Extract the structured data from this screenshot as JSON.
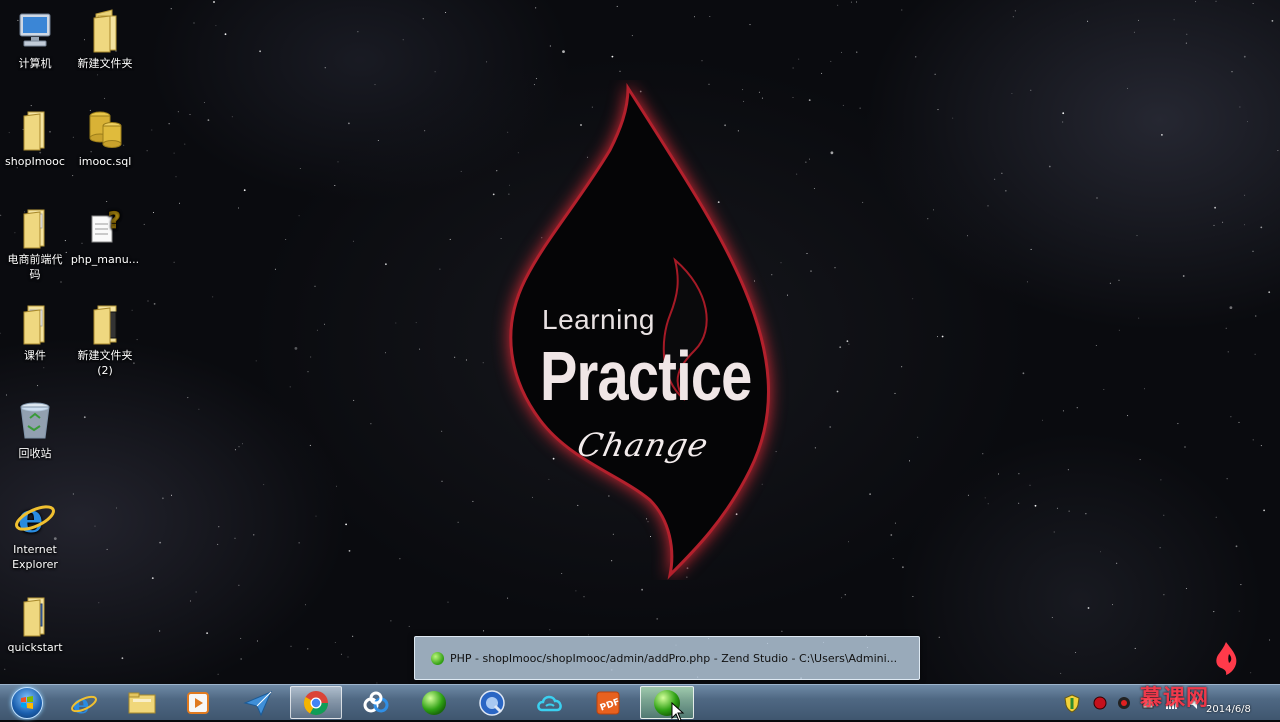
{
  "desktop": {
    "icons": [
      {
        "label": "计算机"
      },
      {
        "label": "新建文件夹"
      },
      {
        "label": "shopImooc"
      },
      {
        "label": "imooc.sql"
      },
      {
        "label": "电商前端代",
        "label2": "码"
      },
      {
        "label": "php_manu..."
      },
      {
        "label": "课件"
      },
      {
        "label": "新建文件夹",
        "label2": "(2)"
      },
      {
        "label": "回收站"
      },
      {
        "label": "Internet",
        "label2": "Explorer"
      },
      {
        "label": "quickstart"
      }
    ]
  },
  "wallpaper": {
    "line1": "Learning",
    "line2": "Practice",
    "line3": "Change",
    "flame_color": "#c0242f"
  },
  "taskbar": {
    "preview_title": "PHP - shopImooc/shopImooc/admin/addPro.php - Zend Studio - C:\\Users\\Admini...",
    "items": [
      {
        "name": "internet-explorer"
      },
      {
        "name": "file-explorer"
      },
      {
        "name": "media-player"
      },
      {
        "name": "feiq-messenger"
      },
      {
        "name": "chrome",
        "active": true
      },
      {
        "name": "baidu-cloud"
      },
      {
        "name": "green-app"
      },
      {
        "name": "quicktime"
      },
      {
        "name": "cloud-sync"
      },
      {
        "name": "pdf-reader"
      },
      {
        "name": "zend-studio",
        "active": true
      }
    ],
    "clock_date": "2014/6/8"
  },
  "watermark": "慕课网",
  "accent": "#ff3344"
}
